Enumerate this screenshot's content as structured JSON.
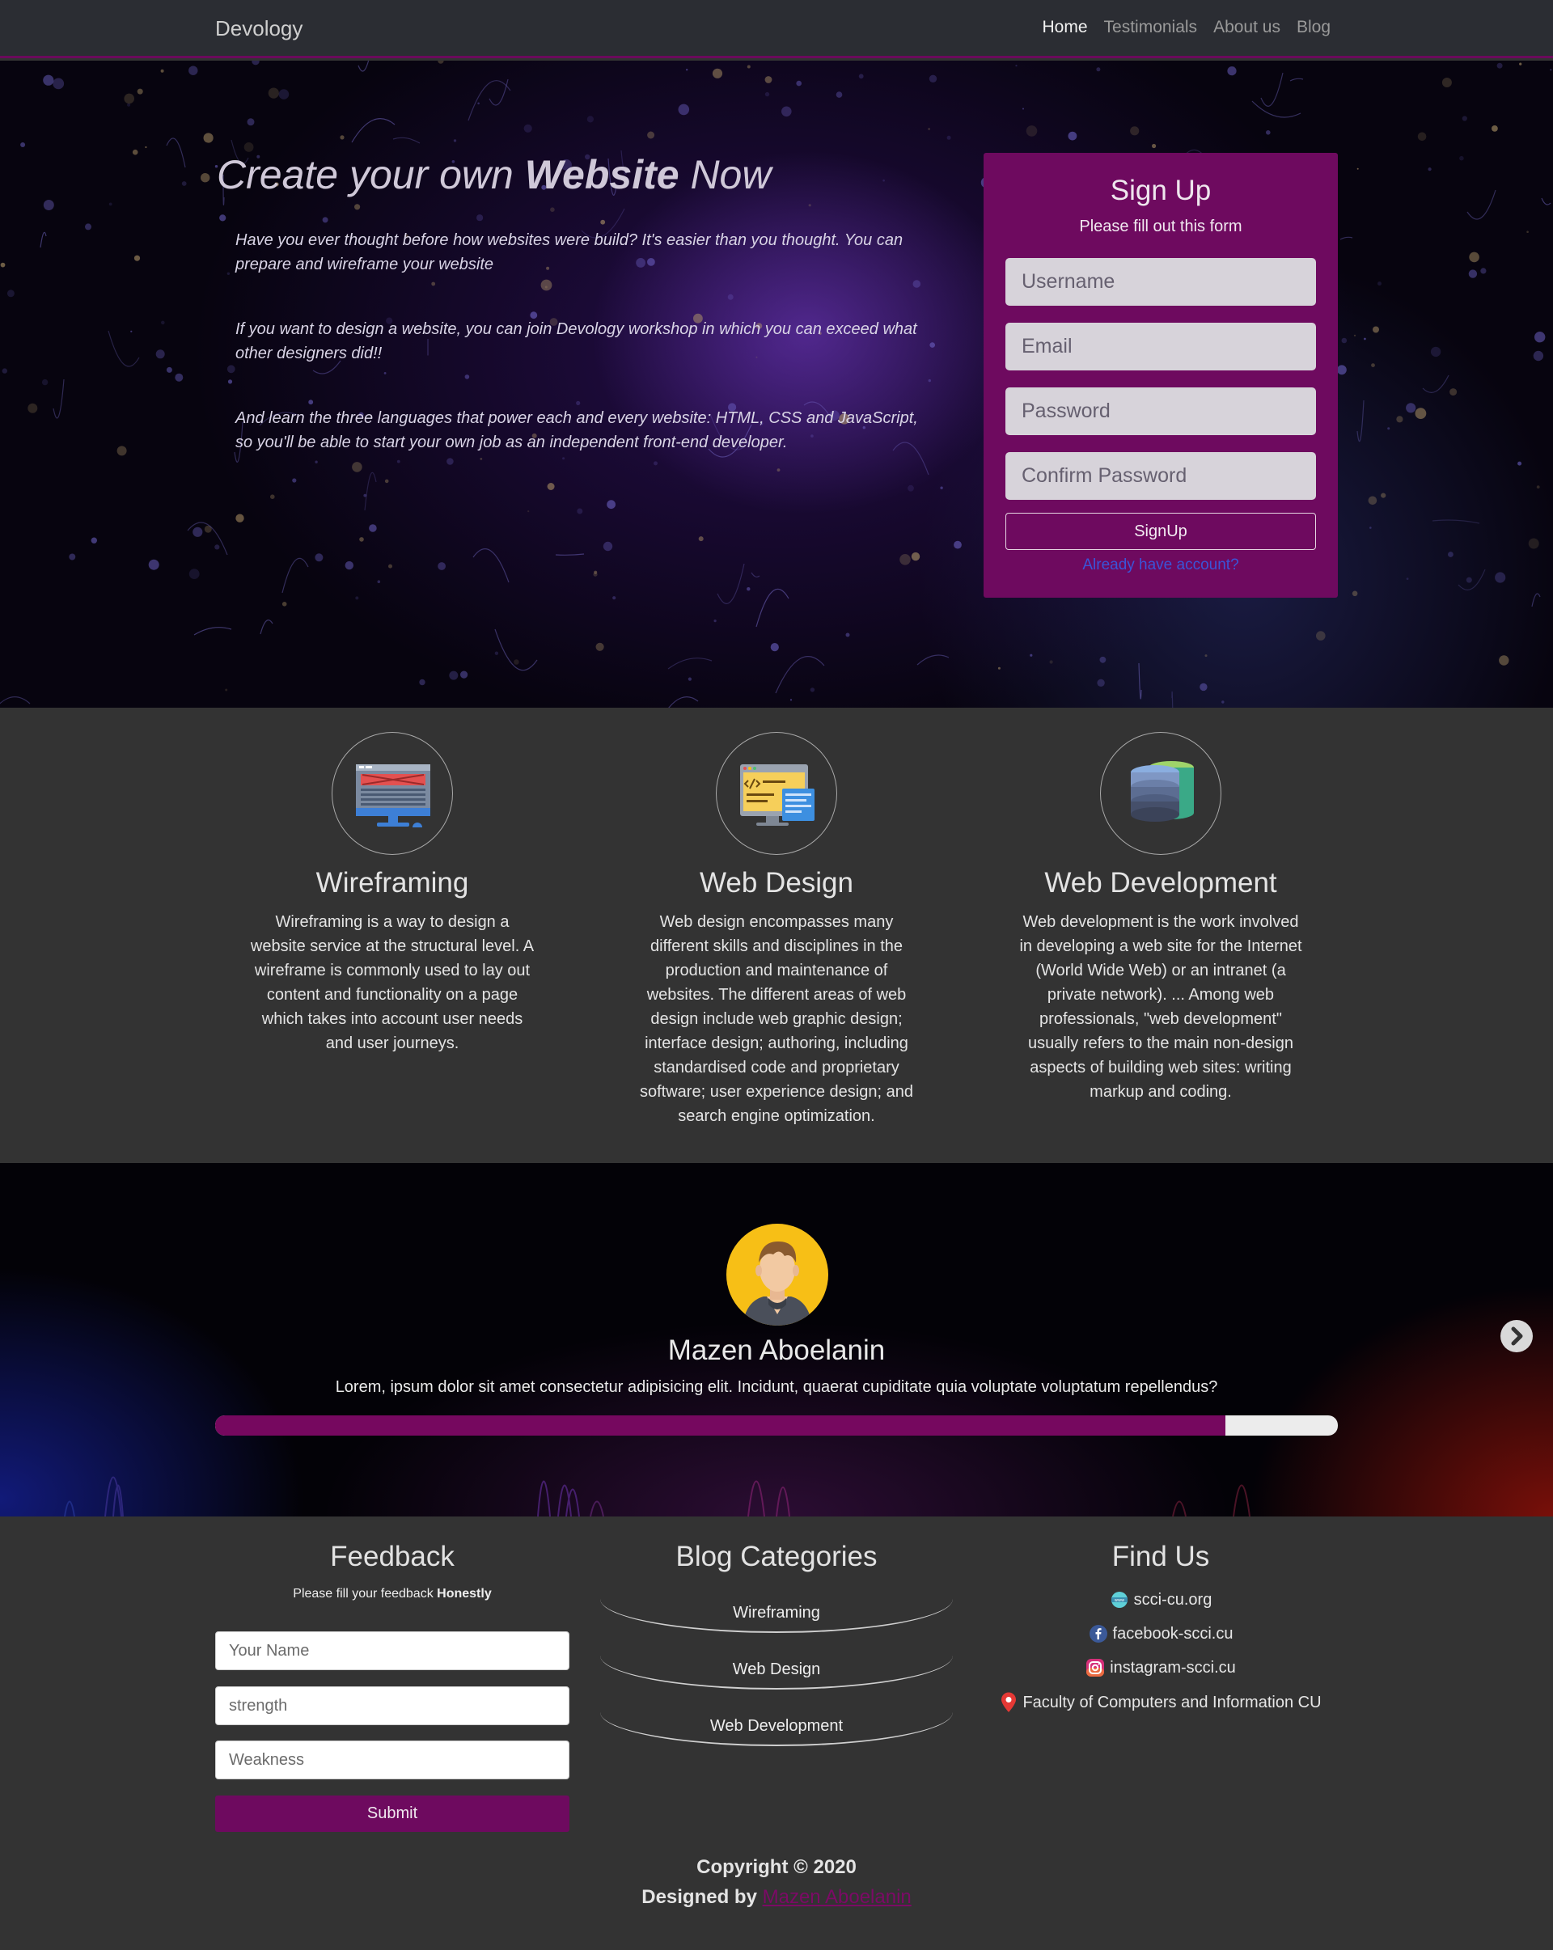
{
  "nav": {
    "brand": "Devology",
    "links": [
      "Home",
      "Testimonials",
      "About us",
      "Blog"
    ]
  },
  "hero": {
    "title_pre": "Create your own ",
    "title_bold": "Website",
    "title_post": " Now",
    "paragraphs": [
      "Have you ever thought before how websites were build? It's easier than you thought. You can prepare and wireframe your website",
      "If you want to design a website, you can join Devology workshop in which you can exceed what other designers did!!",
      "And learn the three languages that power each and every website: HTML, CSS and JavaScript, so you'll be able to start your own job as an independent front-end developer."
    ]
  },
  "signup": {
    "title": "Sign Up",
    "subtitle": "Please fill out this form",
    "username_placeholder": "Username",
    "email_placeholder": "Email",
    "password_placeholder": "Password",
    "confirm_placeholder": "Confirm Password",
    "button": "SignUp",
    "link": "Already have account?"
  },
  "features": [
    {
      "icon": "wireframe-monitor-icon",
      "title": "Wireframing",
      "text": "Wireframing is a way to design a website service at the structural level. A wireframe is commonly used to lay out content and functionality on a page which takes into account user needs and user journeys."
    },
    {
      "icon": "code-monitor-icon",
      "title": "Web Design",
      "text": "Web design encompasses many different skills and disciplines in the production and maintenance of websites. The different areas of web design include web graphic design; interface design; authoring, including standardised code and proprietary software; user experience design; and search engine optimization."
    },
    {
      "icon": "database-icon",
      "title": "Web Development",
      "text": "Web development is the work involved in developing a web site for the Internet (World Wide Web) or an intranet (a private network). ... Among web professionals, \"web development\" usually refers to the main non-design aspects of building web sites: writing markup and coding."
    }
  ],
  "testimonial": {
    "name": "Mazen Aboelanin",
    "text": "Lorem, ipsum dolor sit amet consectetur adipisicing elit. Incidunt, quaerat cupiditate quia voluptate voluptatum repellendus?",
    "progress": 0.9
  },
  "footer": {
    "feedback": {
      "title": "Feedback",
      "sub_pre": "Please fill your feedback ",
      "sub_bold": "Honestly",
      "name_placeholder": "Your Name",
      "strength_placeholder": "strength",
      "weakness_placeholder": "Weakness",
      "submit": "Submit"
    },
    "blog": {
      "title": "Blog Categories",
      "items": [
        "Wireframing",
        "Web Design",
        "Web Development"
      ]
    },
    "find": {
      "title": "Find Us",
      "website": "scci-cu.org",
      "facebook": "facebook-scci.cu",
      "instagram": "instagram-scci.cu",
      "location": "Faculty of Computers and Information CU"
    },
    "copyright": "Copyright © 2020",
    "designed_by": "Designed by ",
    "designer": "Mazen Aboelanin"
  },
  "colors": {
    "accent": "#6e0a5f",
    "navbar": "#2b2d33",
    "section_bg": "#333333",
    "link_blue": "#3a55d8"
  }
}
